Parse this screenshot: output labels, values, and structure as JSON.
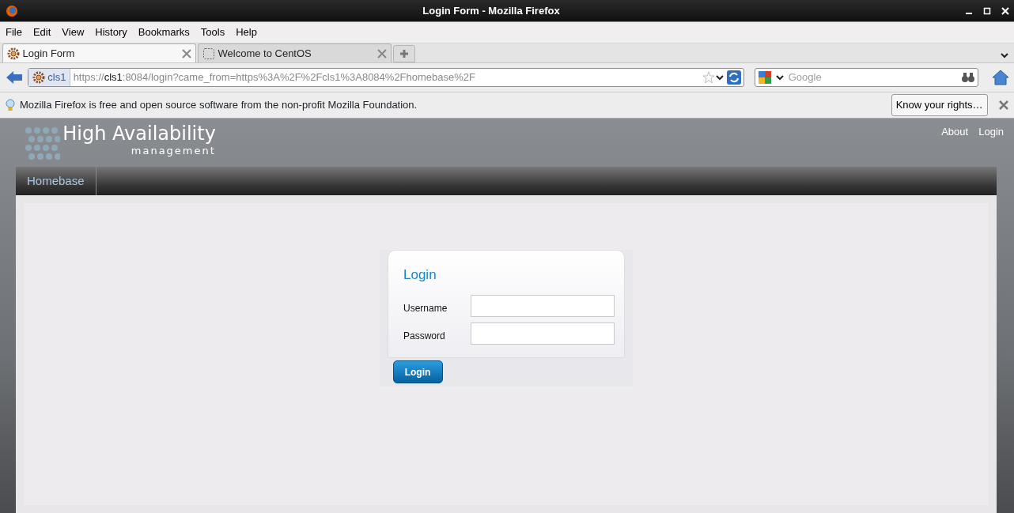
{
  "window": {
    "title": "Login Form - Mozilla Firefox"
  },
  "menu": [
    "File",
    "Edit",
    "View",
    "History",
    "Bookmarks",
    "Tools",
    "Help"
  ],
  "tabs": [
    {
      "label": "Login Form",
      "selected": true,
      "kind": "gear"
    },
    {
      "label": "Welcome to CentOS",
      "selected": false,
      "kind": "blank"
    }
  ],
  "address_bar": {
    "site": "cls1",
    "url": "https://**cls1**:8084/login?came_from=https%3A%2F%2Fcls1%3A8084%2Fhomebase%2F"
  },
  "search": {
    "placeholder": "Google"
  },
  "notification": {
    "message": "Mozilla Firefox is free and open source software from the non-profit Mozilla Foundation.",
    "button": "Know your rights…"
  },
  "site": {
    "logo_title": "High Availability",
    "logo_subtitle": "management",
    "nav_links": [
      "About",
      "Login"
    ],
    "breadcrumb": "Homebase"
  },
  "login": {
    "title": "Login",
    "fields": [
      {
        "label": "Username"
      },
      {
        "label": "Password"
      }
    ],
    "button": "Login"
  }
}
